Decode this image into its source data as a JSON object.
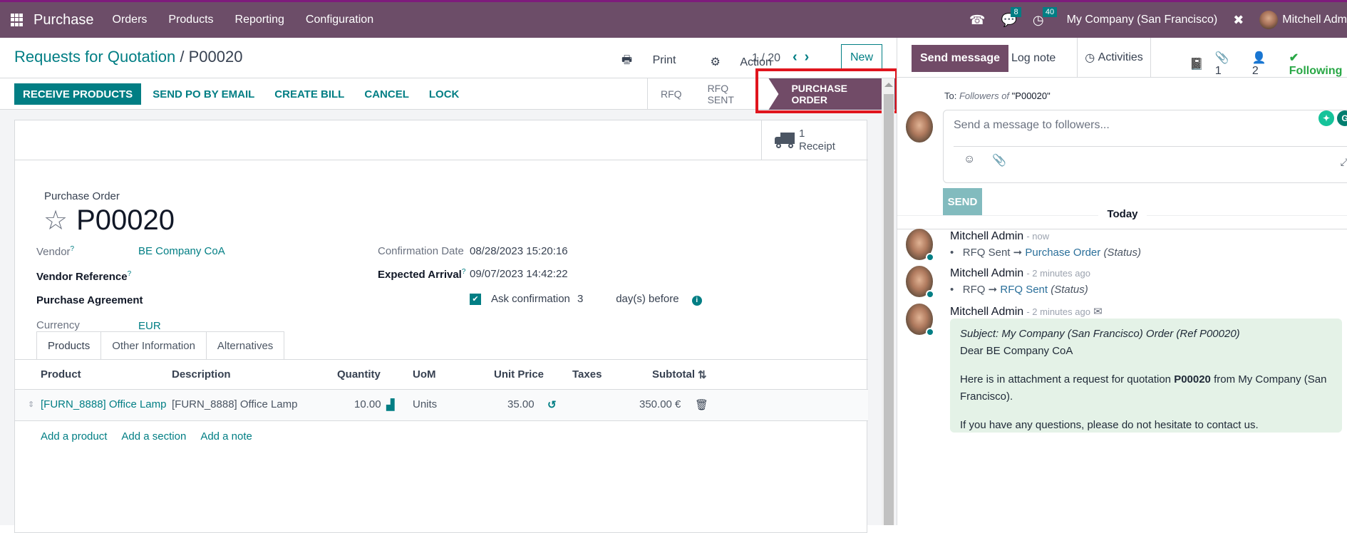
{
  "topbar": {
    "app_name": "Purchase",
    "menu": [
      "Orders",
      "Products",
      "Reporting",
      "Configuration"
    ],
    "messages_badge": "8",
    "activities_badge": "40",
    "company": "My Company (San Francisco)",
    "user": "Mitchell Adm"
  },
  "control_panel": {
    "breadcrumb_parent": "Requests for Quotation",
    "breadcrumb_sep": "/",
    "breadcrumb_current": "P00020",
    "print_label": "Print",
    "action_label": "Action",
    "pager": "1 / 20",
    "new_label": "New"
  },
  "statusbar": {
    "buttons": [
      "RECEIVE PRODUCTS",
      "SEND PO BY EMAIL",
      "CREATE BILL",
      "CANCEL",
      "LOCK"
    ],
    "stages": [
      "RFQ",
      "RFQ SENT",
      "PURCHASE ORDER"
    ],
    "active_stage": "PURCHASE ORDER"
  },
  "smart_button": {
    "count": "1",
    "label": "Receipt"
  },
  "form": {
    "title_label": "Purchase Order",
    "title": "P00020",
    "vendor_label": "Vendor",
    "vendor": "BE Company CoA",
    "vendor_ref_label": "Vendor Reference",
    "agreement_label": "Purchase Agreement",
    "currency_label": "Currency",
    "currency": "EUR",
    "confirmation_date_label": "Confirmation Date",
    "confirmation_date": "08/28/2023 15:20:16",
    "expected_arrival_label": "Expected Arrival",
    "expected_arrival": "09/07/2023 14:42:22",
    "ask_confirmation_label": "Ask confirmation",
    "ask_confirmation_days": "3",
    "days_before_label": "day(s) before",
    "help_mark": "?"
  },
  "tabs": [
    "Products",
    "Other Information",
    "Alternatives"
  ],
  "table": {
    "headers": [
      "Product",
      "Description",
      "Quantity",
      "UoM",
      "Unit Price",
      "Taxes",
      "Subtotal"
    ],
    "rows": [
      {
        "product": "[FURN_8888] Office Lamp",
        "description": "[FURN_8888] Office Lamp",
        "quantity": "10.00",
        "uom": "Units",
        "unit_price": "35.00",
        "taxes": "",
        "subtotal": "350.00 €"
      }
    ],
    "add_links": [
      "Add a product",
      "Add a section",
      "Add a note"
    ]
  },
  "chatter": {
    "send_message": "Send message",
    "log_note": "Log note",
    "activities": "Activities",
    "attachments_count": "1",
    "followers_count": "2",
    "following": "Following",
    "to_prefix": "To:",
    "to_followers": "Followers of",
    "to_record": "\"P00020\"",
    "composer_placeholder": "Send a message to followers...",
    "send_label": "SEND",
    "date_separator": "Today",
    "messages": [
      {
        "author": "Mitchell Admin",
        "time": "- now",
        "old": "RFQ Sent",
        "new": "Purchase Order",
        "field": "(Status)"
      },
      {
        "author": "Mitchell Admin",
        "time": "- 2 minutes ago",
        "old": "RFQ",
        "new": "RFQ Sent",
        "field": "(Status)"
      },
      {
        "author": "Mitchell Admin",
        "time": "- 2 minutes ago"
      }
    ],
    "email": {
      "subject": "Subject: My Company (San Francisco) Order (Ref P00020)",
      "greeting": "Dear BE Company CoA",
      "line1_pre": "Here is in attachment a request for quotation",
      "line1_bold": "P00020",
      "line1_post": "from My Company (San Francisco).",
      "line2": "If you have any questions, please do not hesitate to contact us."
    }
  }
}
